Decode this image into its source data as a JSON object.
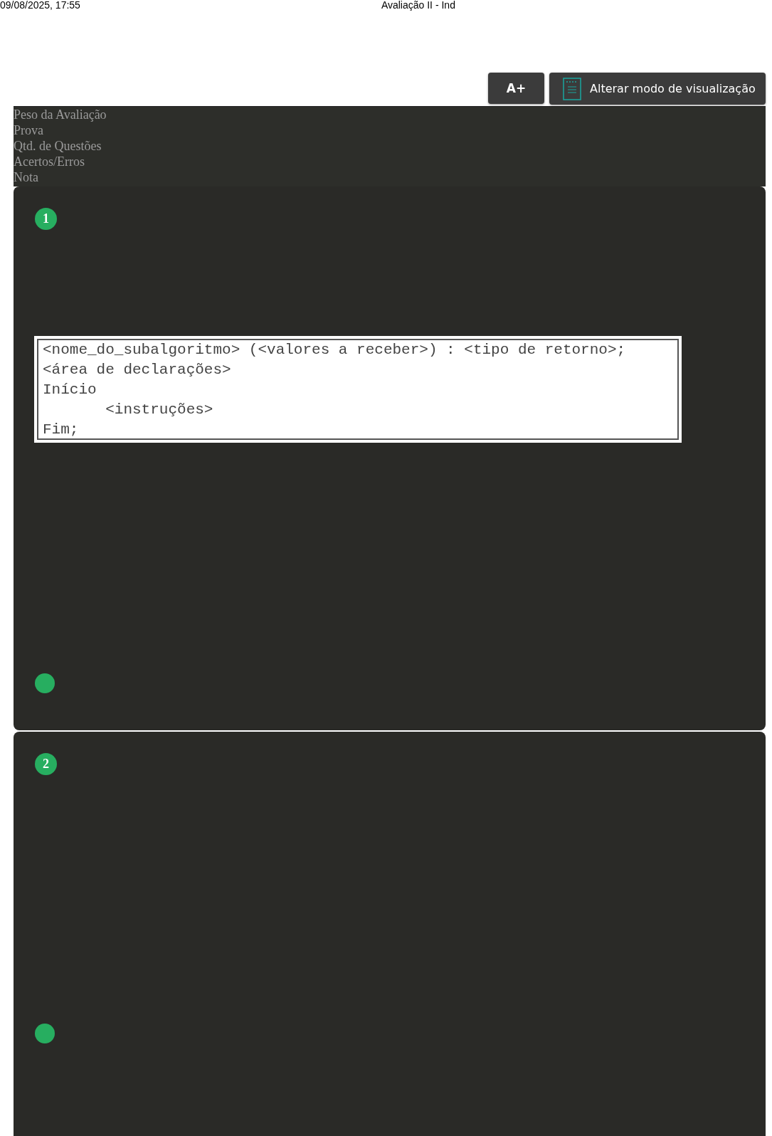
{
  "print_header": {
    "date": "09/08/2025, 17:55",
    "title": "Avaliação II - Ind"
  },
  "toolbar": {
    "font_button": "A+",
    "view_button": "Alterar modo de visualização"
  },
  "summary": [
    "Peso da Avaliação",
    "Prova",
    "Qtd. de Questões",
    "Acertos/Erros",
    "Nota"
  ],
  "questions": [
    {
      "number": "1",
      "code": [
        "<nome_do_subalgoritmo> (<valores a receber>) : <tipo de retorno>;",
        "<área de declarações>",
        "Início",
        "       <instruções>",
        "Fim;"
      ]
    },
    {
      "number": "2"
    }
  ]
}
